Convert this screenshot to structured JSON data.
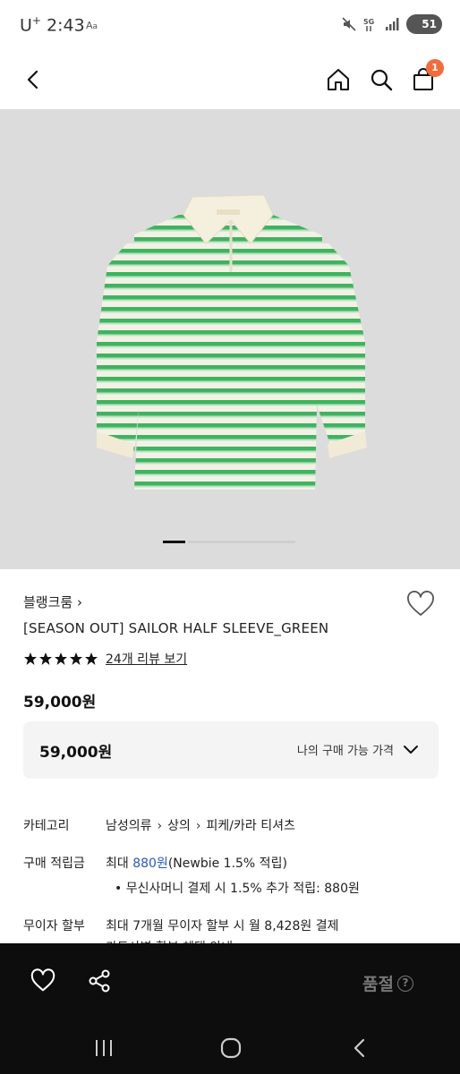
{
  "status": {
    "carrier": "U",
    "carrier_sup": "+",
    "time": "2:43",
    "battery": "51"
  },
  "header": {
    "cart_count": "1"
  },
  "product": {
    "brand": "블랭크룸",
    "brand_chevron": "›",
    "title": "[SEASON OUT] SAILOR HALF SLEEVE_GREEN",
    "rating_stars": 5,
    "review_link": "24개 리뷰 보기",
    "price": "59,000원",
    "price_box_amount": "59,000원",
    "my_price_label": "나의 구매 가능 가격",
    "image_colors": {
      "background": "#dcdcdc",
      "stripe_green": "#3fb35f",
      "base": "#f3f1e6",
      "collar": "#f5f0de"
    }
  },
  "details": {
    "category_label": "카테고리",
    "category_path": [
      "남성의류",
      "상의",
      "피케/카라 티셔츠"
    ],
    "points_label": "구매 적립금",
    "points_prefix": "최대 ",
    "points_amount": "880원",
    "points_suffix": "(Newbie 1.5% 적립)",
    "points_bullet": "• 무신사머니 결제 시 1.5% 추가 적립: 880원",
    "installment_label": "무이자 할부",
    "installment_value": "최대 7개월 무이자 할부 시 월 8,428원 결제",
    "installment_more": "카드사별 할부 혜택 안내"
  },
  "bottom_bar": {
    "sold_out_label": "품절",
    "help_mark": "?"
  }
}
